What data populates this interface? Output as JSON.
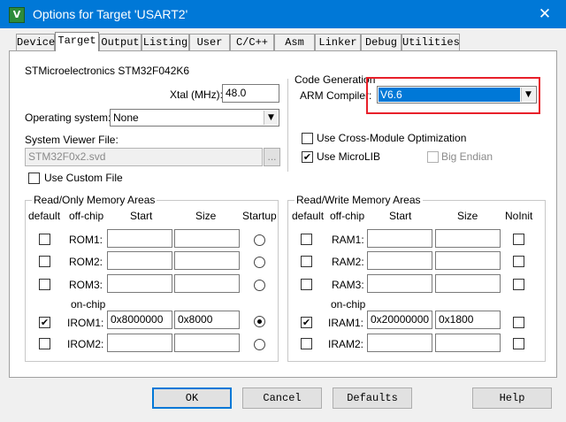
{
  "window": {
    "app_icon": "keil-uvision-icon",
    "title": "Options for Target 'USART2'",
    "close_glyph": "✕"
  },
  "tabs": [
    "Device",
    "Target",
    "Output",
    "Listing",
    "User",
    "C/C++",
    "Asm",
    "Linker",
    "Debug",
    "Utilities"
  ],
  "active_tab": "Target",
  "device_name": "STMicroelectronics STM32F042K6",
  "xtal": {
    "label": "Xtal (MHz):",
    "value": "48.0"
  },
  "os": {
    "label": "Operating system:",
    "value": "None"
  },
  "svd": {
    "label": "System Viewer File:",
    "value": "STM32F0x2.svd",
    "browse": "...",
    "custom_label": "Use Custom File"
  },
  "codegen": {
    "title": "Code Generation",
    "compiler_label": "ARM Compiler:",
    "compiler_value": "V6.6",
    "cross_module": "Use Cross-Module Optimization",
    "microlib": "Use MicroLIB",
    "big_endian": "Big Endian"
  },
  "rom": {
    "title": "Read/Only Memory Areas",
    "headers": {
      "default": "default",
      "offchip": "off-chip",
      "start": "Start",
      "size": "Size",
      "last": "Startup"
    },
    "onchip_label": "on-chip",
    "rows": [
      {
        "name": "ROM1:",
        "start": "",
        "size": "",
        "checked": false,
        "radio": false
      },
      {
        "name": "ROM2:",
        "start": "",
        "size": "",
        "checked": false,
        "radio": false
      },
      {
        "name": "ROM3:",
        "start": "",
        "size": "",
        "checked": false,
        "radio": false
      },
      {
        "name": "IROM1:",
        "start": "0x8000000",
        "size": "0x8000",
        "checked": true,
        "radio": true
      },
      {
        "name": "IROM2:",
        "start": "",
        "size": "",
        "checked": false,
        "radio": false
      }
    ]
  },
  "ram": {
    "title": "Read/Write Memory Areas",
    "headers": {
      "default": "default",
      "offchip": "off-chip",
      "start": "Start",
      "size": "Size",
      "last": "NoInit"
    },
    "onchip_label": "on-chip",
    "rows": [
      {
        "name": "RAM1:",
        "start": "",
        "size": "",
        "checked": false
      },
      {
        "name": "RAM2:",
        "start": "",
        "size": "",
        "checked": false
      },
      {
        "name": "RAM3:",
        "start": "",
        "size": "",
        "checked": false
      },
      {
        "name": "IRAM1:",
        "start": "0x20000000",
        "size": "0x1800",
        "checked": true
      },
      {
        "name": "IRAM2:",
        "start": "",
        "size": "",
        "checked": false
      }
    ]
  },
  "buttons": {
    "ok": "OK",
    "cancel": "Cancel",
    "defaults": "Defaults",
    "help": "Help"
  },
  "colors": {
    "titlebar": "#0078d7",
    "highlight": "#e8202a",
    "selection": "#0078d7"
  }
}
